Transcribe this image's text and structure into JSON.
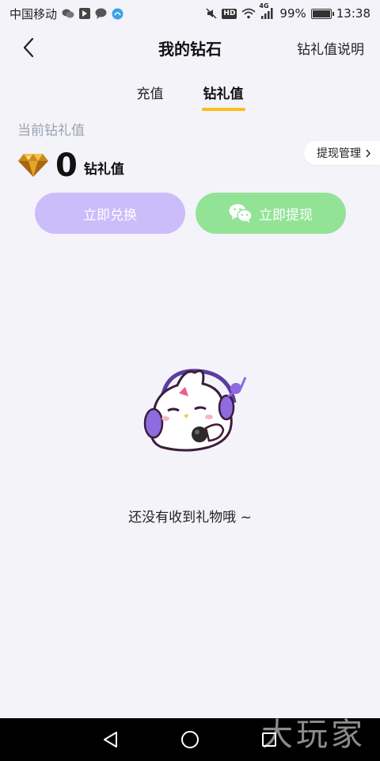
{
  "status_bar": {
    "carrier": "中国移动",
    "network": "4G",
    "battery": "99%",
    "battery_level": 0.99,
    "time": "13:38",
    "hd_badge": "HD"
  },
  "navbar": {
    "title": "我的钻石",
    "right_link": "钻礼值说明"
  },
  "tabs": [
    {
      "label": "充值",
      "active": false
    },
    {
      "label": "钻礼值",
      "active": true
    }
  ],
  "balance": {
    "caption": "当前钻礼值",
    "value": "0",
    "unit": "钻礼值",
    "manage_link": "提现管理"
  },
  "actions": {
    "exchange_label": "立即兑换",
    "withdraw_label": "立即提现"
  },
  "empty_state": {
    "message": "还没有收到礼物哦 ~"
  },
  "watermark": "大玩家",
  "colors": {
    "background": "#f4f3fa",
    "tab_underline": "#f6c21b",
    "exchange_button": "#cbbdfa",
    "withdraw_button": "#93e397",
    "caption_gray": "#9aa2b1"
  },
  "icons": {
    "back": "chevron-left-icon",
    "gem": "diamond-icon",
    "wechat": "wechat-icon",
    "manage_arrow": "chevron-right-icon"
  }
}
